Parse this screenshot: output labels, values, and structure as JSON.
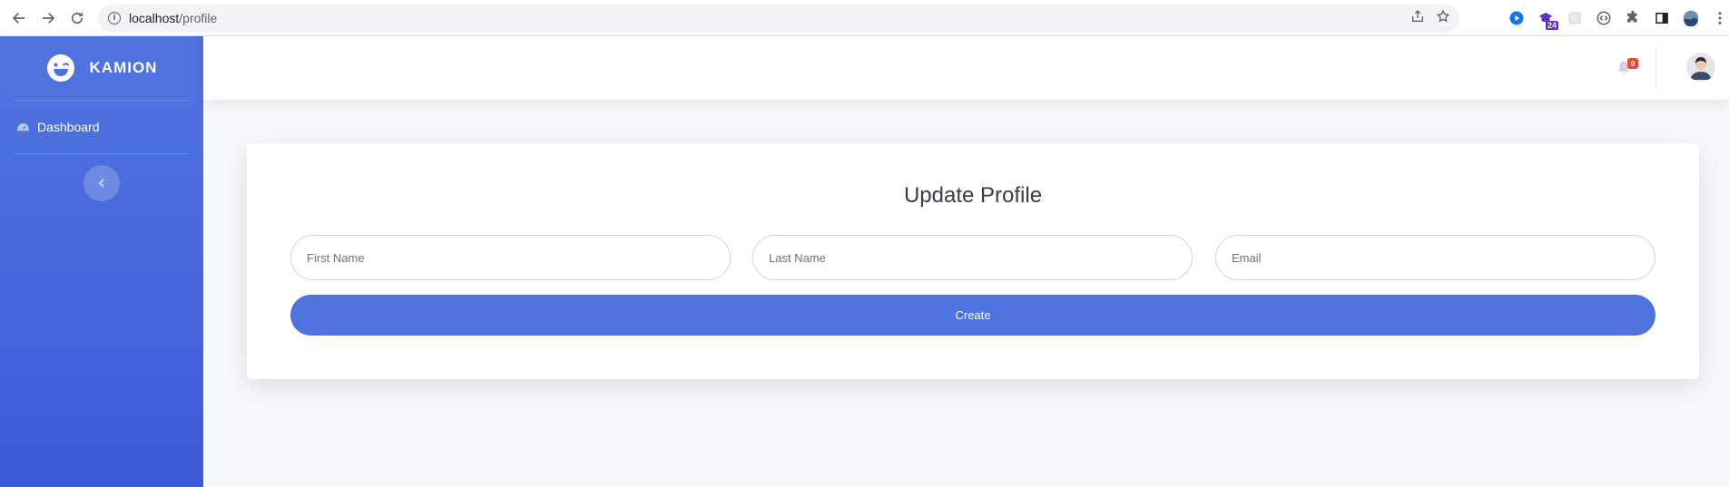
{
  "browser": {
    "url_host": "localhost",
    "url_path": "/profile",
    "ext_badge": "24"
  },
  "sidebar": {
    "brand": "KAMION",
    "items": [
      {
        "label": "Dashboard",
        "icon": "tachometer-icon"
      }
    ]
  },
  "topbar": {
    "notification_count": "0"
  },
  "form": {
    "title": "Update Profile",
    "first_name_placeholder": "First Name",
    "last_name_placeholder": "Last Name",
    "email_placeholder": "Email",
    "submit_label": "Create"
  },
  "colors": {
    "primary": "#4e73df",
    "badge": "#e74a3b"
  }
}
